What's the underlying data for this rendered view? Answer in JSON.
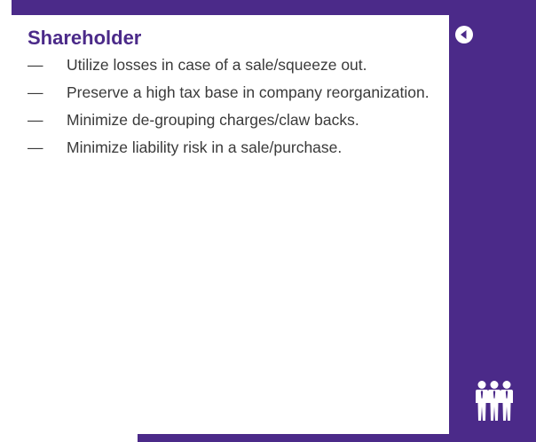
{
  "slide": {
    "heading": "Shareholder",
    "bullets": [
      {
        "dash": "—",
        "text": "Utilize losses in case of a sale/squeeze out."
      },
      {
        "dash": "—",
        "text": "Preserve a high tax base in company reorganization."
      },
      {
        "dash": "—",
        "text": "Minimize de-grouping charges/claw backs."
      },
      {
        "dash": "—",
        "text": "Minimize liability risk in a sale/purchase."
      }
    ]
  },
  "controls": {
    "back_icon": "back-arrow-circle-icon"
  },
  "decoration": {
    "people_icon": "three-people-icon"
  },
  "colors": {
    "brand_purple": "#4b2a89",
    "heading_text": "#4b2a89",
    "body_text": "#3a3a3a",
    "background": "#ffffff"
  }
}
